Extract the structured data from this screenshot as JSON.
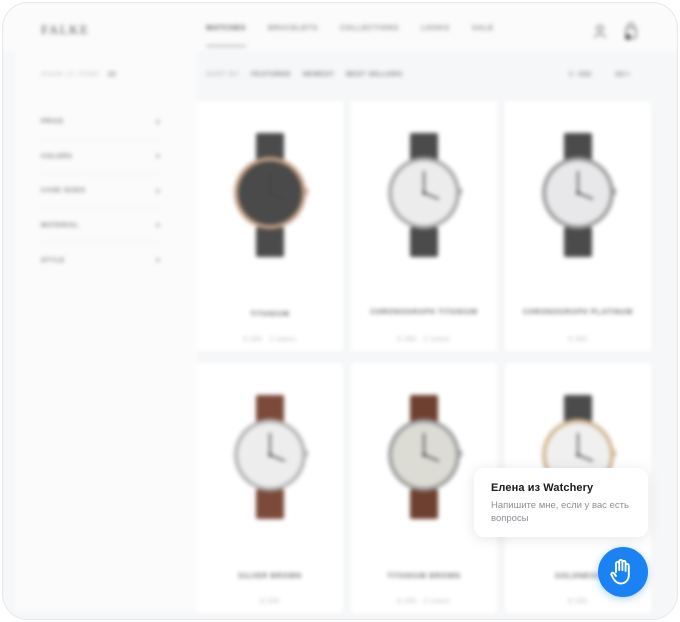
{
  "header": {
    "logo": "FALKE",
    "nav": [
      "WATCHES",
      "BRACELETS",
      "COLLECTIONS",
      "LOOKS",
      "SALE"
    ]
  },
  "sidebar": {
    "show_label": "SHOW 12 ITEMS",
    "show_value": "12",
    "filters": [
      "PRICE",
      "COLORS",
      "CASE SIZES",
      "MATERIAL",
      "STYLE"
    ]
  },
  "sortbar": {
    "label": "SORT BY",
    "options": [
      "FEATURED",
      "NEWEST",
      "BEST SELLERS"
    ],
    "pager_left": "1 - 1/12",
    "pager_right": "1/2 >"
  },
  "products": [
    {
      "name": "TITANIUM",
      "price": "€ 200  ·  2 colors",
      "case": "#c7a186",
      "dial": "#4a4a4a",
      "strap": "#4b4b4b"
    },
    {
      "name": "CHRONOGRAPH TITANIUM",
      "price": "€ 250  ·  2 colors",
      "case": "#a9a9a9",
      "dial": "#ececec",
      "strap": "#4b4b4b"
    },
    {
      "name": "CHRONOGRAPH PLATINUM",
      "price": "€ 250",
      "case": "#9c9c9c",
      "dial": "#e8e8ea",
      "strap": "#4b4b4b"
    },
    {
      "name": "SILVER BROWN",
      "price": "€ 200",
      "case": "#b5b5b5",
      "dial": "#ededed",
      "strap": "#7b4a3a"
    },
    {
      "name": "TITANIUM BROWN",
      "price": "€ 200  ·  2 colors",
      "case": "#9d9d9d",
      "dial": "#dcdcd4",
      "strap": "#6e4030"
    },
    {
      "name": "GOLDNESS",
      "price": "€ 200",
      "case": "#d2b894",
      "dial": "#f0f0f0",
      "strap": "#4b4b4b"
    }
  ],
  "chat": {
    "title": "Елена из Watchery",
    "text": "Напишите мне, если у вас есть вопросы",
    "button_icon": "hand-wave-icon",
    "accent": "#1a82f3"
  }
}
